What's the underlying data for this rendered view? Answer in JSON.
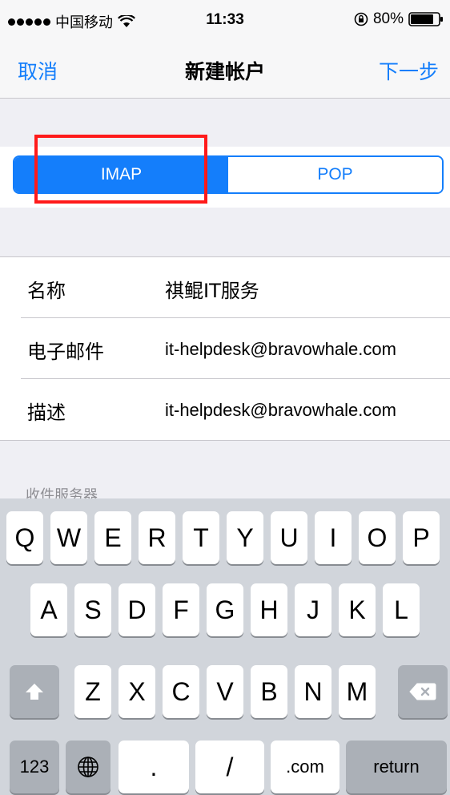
{
  "status_bar": {
    "carrier": "中国移动",
    "time": "11:33",
    "battery": "80%",
    "signal_bars": 5,
    "icons": [
      "wifi-icon",
      "rotation-lock-icon",
      "battery-icon"
    ]
  },
  "nav": {
    "cancel_label": "取消",
    "title": "新建帐户",
    "next_label": "下一步"
  },
  "segmented": {
    "options": [
      {
        "label": "IMAP",
        "selected": true
      },
      {
        "label": "POP",
        "selected": false
      }
    ]
  },
  "form": {
    "rows": [
      {
        "label": "名称",
        "value": "祺鲲IT服务"
      },
      {
        "label": "电子邮件",
        "value": "it-helpdesk@bravowhale.com"
      },
      {
        "label": "描述",
        "value": "it-helpdesk@bravowhale.com"
      }
    ]
  },
  "section_header": "收件服务器",
  "keyboard": {
    "row1": [
      "Q",
      "W",
      "E",
      "R",
      "T",
      "Y",
      "U",
      "I",
      "O",
      "P"
    ],
    "row2": [
      "A",
      "S",
      "D",
      "F",
      "G",
      "H",
      "J",
      "K",
      "L"
    ],
    "row3": [
      "Z",
      "X",
      "C",
      "V",
      "B",
      "N",
      "M"
    ],
    "row4": {
      "numbers": "123",
      "period": ".",
      "slash": "/",
      "dotcom": ".com",
      "return": "return"
    }
  },
  "colors": {
    "accent": "#147efb",
    "highlight": "#ff1a1a",
    "keyboard_bg": "#d1d5db"
  }
}
